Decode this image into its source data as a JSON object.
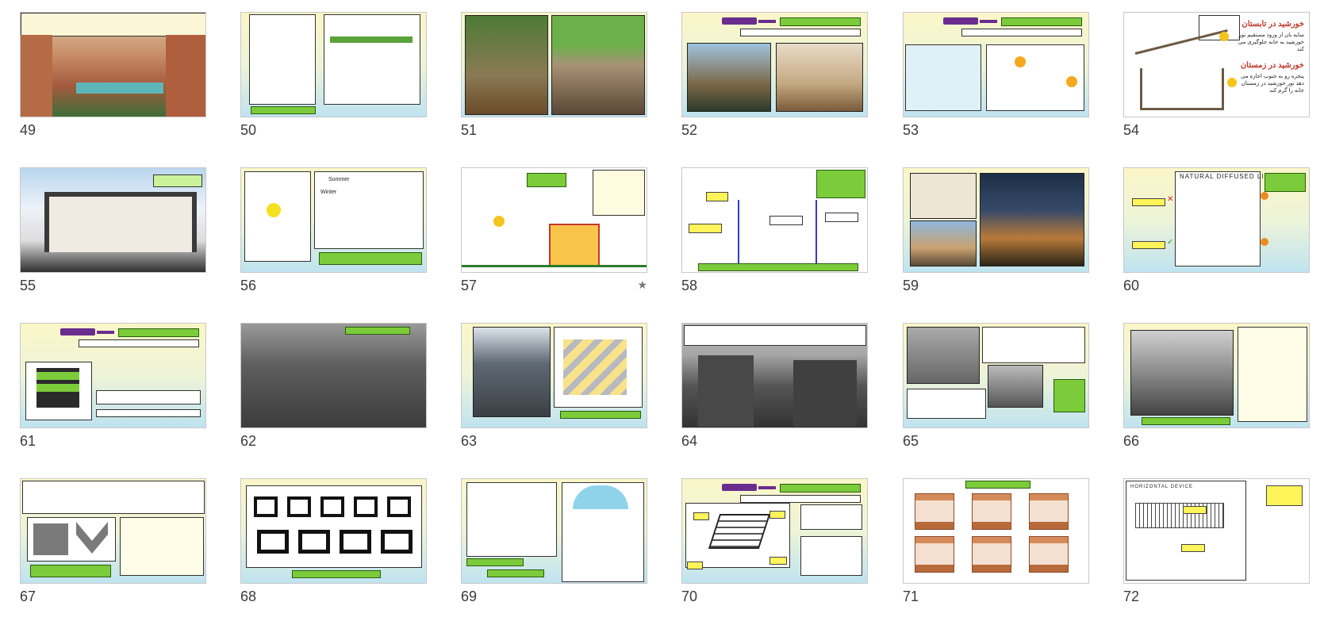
{
  "slides": [
    {
      "num": "49",
      "row": 0,
      "col": 0,
      "style": "photo-court"
    },
    {
      "num": "50",
      "row": 0,
      "col": 1,
      "style": "diagrams-green"
    },
    {
      "num": "51",
      "row": 0,
      "col": 2,
      "style": "two-photos"
    },
    {
      "num": "52",
      "row": 0,
      "col": 3,
      "style": "title-two-photos"
    },
    {
      "num": "53",
      "row": 0,
      "col": 4,
      "style": "title-diagrams"
    },
    {
      "num": "54",
      "row": 0,
      "col": 5,
      "style": "sun-house",
      "summer_title": "خورشید در تابستان",
      "summer_text": "سایه بان از ورود مستقیم نور خورشید به خانه جلوگیری می کند",
      "winter_title": "خورشید در زمستان",
      "winter_text": "پنجره رو به جنوب اجازه می دهد نور خورشید در زمستان خانه را گرم کند"
    },
    {
      "num": "55",
      "row": 1,
      "col": 0,
      "style": "section-photo"
    },
    {
      "num": "56",
      "row": 1,
      "col": 1,
      "style": "sun-angles",
      "label_summer": "Summer",
      "label_winter": "Winter"
    },
    {
      "num": "57",
      "row": 1,
      "col": 2,
      "style": "sun-dome",
      "starred": true
    },
    {
      "num": "58",
      "row": 1,
      "col": 3,
      "style": "section-drawing"
    },
    {
      "num": "59",
      "row": 1,
      "col": 4,
      "style": "three-photos"
    },
    {
      "num": "60",
      "row": 1,
      "col": 5,
      "style": "diffused-light",
      "heading": "NATURAL DIFFUSED LIGHT"
    },
    {
      "num": "61",
      "row": 2,
      "col": 0,
      "style": "title-list"
    },
    {
      "num": "62",
      "row": 2,
      "col": 1,
      "style": "aerial-gray"
    },
    {
      "num": "63",
      "row": 2,
      "col": 2,
      "style": "photo-iso"
    },
    {
      "num": "64",
      "row": 2,
      "col": 3,
      "style": "gray-buildings"
    },
    {
      "num": "65",
      "row": 2,
      "col": 4,
      "style": "photos-text"
    },
    {
      "num": "66",
      "row": 2,
      "col": 5,
      "style": "photo-text-right"
    },
    {
      "num": "67",
      "row": 3,
      "col": 0,
      "style": "text-blocks"
    },
    {
      "num": "68",
      "row": 3,
      "col": 1,
      "style": "block-shapes"
    },
    {
      "num": "69",
      "row": 3,
      "col": 2,
      "style": "dome-section"
    },
    {
      "num": "70",
      "row": 3,
      "col": 3,
      "style": "title-box"
    },
    {
      "num": "71",
      "row": 3,
      "col": 4,
      "style": "shading-devices"
    },
    {
      "num": "72",
      "row": 3,
      "col": 5,
      "style": "horizontal-device",
      "heading": "HORIZONTAL DEVICE"
    }
  ],
  "colors": {
    "accent_green": "#7ccb3a",
    "accent_purple": "#6a2d8f",
    "accent_yellow": "#fff45a",
    "label_text": "#3b3b3b"
  }
}
